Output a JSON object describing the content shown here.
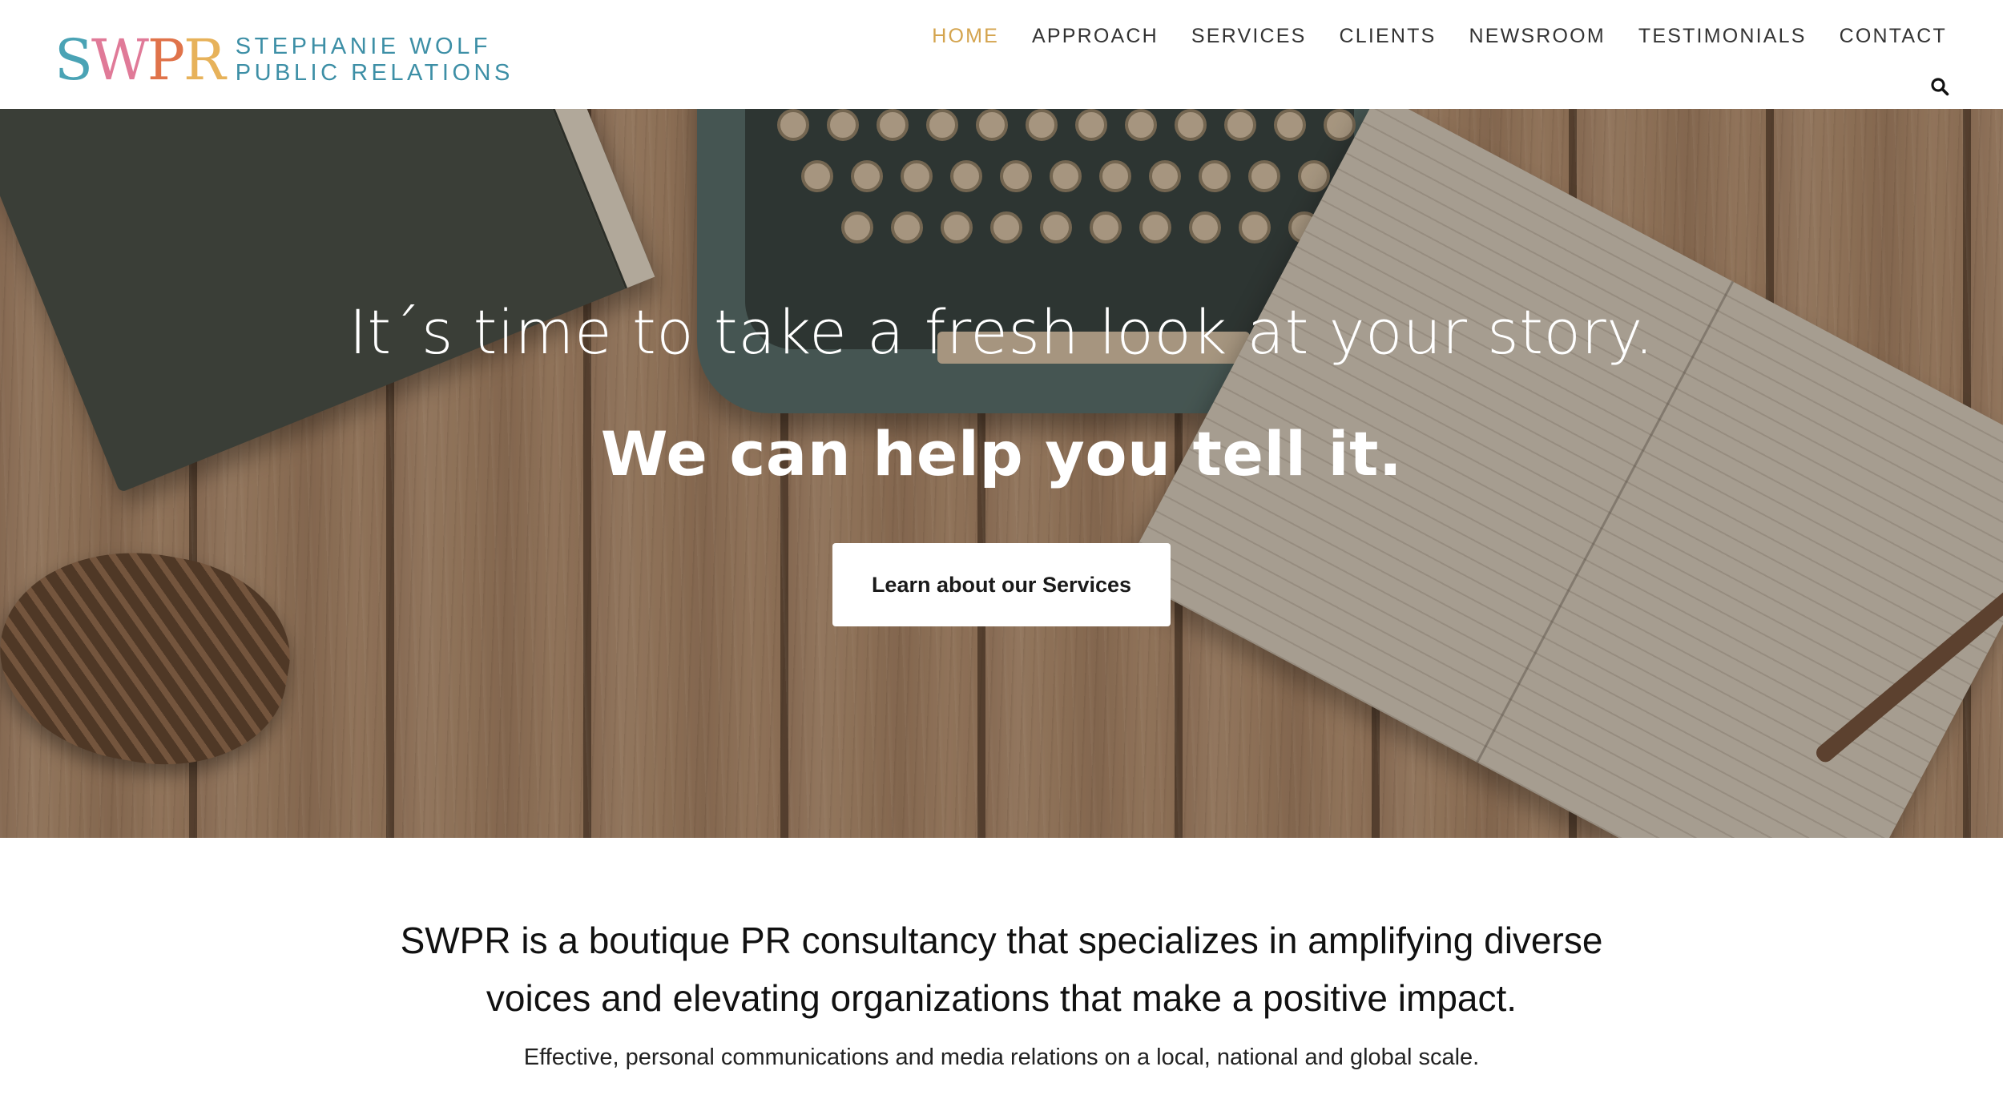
{
  "brand": {
    "logo_letters": [
      "S",
      "W",
      "P",
      "R"
    ],
    "name_line1": "STEPHANIE WOLF",
    "name_line2": "PUBLIC RELATIONS",
    "colors": {
      "s": "#4aa3b5",
      "w": "#e07a98",
      "p": "#e0734a",
      "r": "#e7b25a",
      "text": "#3d8fa6"
    }
  },
  "nav": {
    "items": [
      {
        "label": "HOME",
        "active": true
      },
      {
        "label": "APPROACH",
        "active": false
      },
      {
        "label": "SERVICES",
        "active": false
      },
      {
        "label": "CLIENTS",
        "active": false
      },
      {
        "label": "NEWSROOM",
        "active": false
      },
      {
        "label": "TESTIMONIALS",
        "active": false
      },
      {
        "label": "CONTACT",
        "active": false
      }
    ],
    "active_color": "#d4a44e",
    "search_icon": "search-icon"
  },
  "hero": {
    "line1": "It´s time to take a fresh look at your story.",
    "line2": "We can help you tell it.",
    "cta_label": "Learn about our Services"
  },
  "intro": {
    "heading": "SWPR is a boutique PR consultancy that specializes in amplifying diverse voices and elevating organizations that make a positive impact.",
    "subheading": "Effective, personal communications and media relations on a local, national and global scale."
  }
}
